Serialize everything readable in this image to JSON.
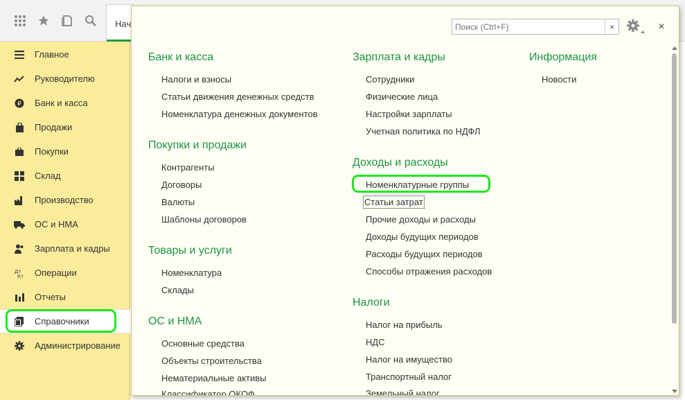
{
  "toolbar": {
    "icons": [
      "apps-grid-icon",
      "star-icon",
      "history-icon",
      "search-icon"
    ],
    "tab_label": "Нач"
  },
  "sidebar": {
    "items": [
      {
        "label": "Главное",
        "icon": "menu-lines-icon"
      },
      {
        "label": "Руководителю",
        "icon": "trend-icon"
      },
      {
        "label": "Банк и касса",
        "icon": "ruble-coin-icon"
      },
      {
        "label": "Продажи",
        "icon": "shopping-bag-icon"
      },
      {
        "label": "Покупки",
        "icon": "basket-icon"
      },
      {
        "label": "Склад",
        "icon": "warehouse-grid-icon"
      },
      {
        "label": "Производство",
        "icon": "factory-icon"
      },
      {
        "label": "ОС и НМА",
        "icon": "truck-icon"
      },
      {
        "label": "Зарплата и кадры",
        "icon": "people-icon"
      },
      {
        "label": "Операции",
        "icon": "debit-credit-icon"
      },
      {
        "label": "Отчеты",
        "icon": "bar-chart-icon"
      },
      {
        "label": "Справочники",
        "icon": "books-icon"
      },
      {
        "label": "Администрирование",
        "icon": "gear-icon"
      }
    ],
    "active_index": 11
  },
  "panel": {
    "search_placeholder": "Поиск (Ctrl+F)",
    "clear_label": "×",
    "close_label": "×",
    "sections": [
      {
        "title": "Банк и касса",
        "links": [
          "Налоги и взносы",
          "Статьи движения денежных средств",
          "Номенклатура денежных документов"
        ]
      },
      {
        "title": "Покупки и продажи",
        "links": [
          "Контрагенты",
          "Договоры",
          "Валюты",
          "Шаблоны договоров"
        ]
      },
      {
        "title": "Товары и услуги",
        "links": [
          "Номенклатура",
          "Склады"
        ]
      },
      {
        "title": "ОС и НМА",
        "links": [
          "Основные средства",
          "Объекты строительства",
          "Нематериальные активы",
          "Классификатор ОКОФ"
        ]
      },
      {
        "title": "Зарплата и кадры",
        "links": [
          "Сотрудники",
          "Физические лица",
          "Настройки зарплаты",
          "Учетная политика по НДФЛ"
        ]
      },
      {
        "title": "Доходы и расходы",
        "links": [
          "Номенклатурные группы",
          "Статьи затрат",
          "Прочие доходы и расходы",
          "Доходы будущих периодов",
          "Расходы будущих периодов",
          "Способы отражения расходов"
        ]
      },
      {
        "title": "Налоги",
        "links": [
          "Налог на прибыль",
          "НДС",
          "Налог на имущество",
          "Транспортный налог",
          "Земельный налог"
        ]
      },
      {
        "title": "Информация",
        "links": [
          "Новости"
        ]
      }
    ]
  }
}
